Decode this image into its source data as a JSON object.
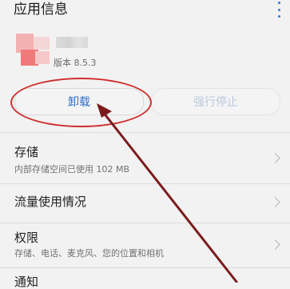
{
  "header": {
    "title": "应用信息",
    "more_icon": "more-vert-icon",
    "accent_color": "#2f74d9"
  },
  "app": {
    "version": "版本 8.5.3"
  },
  "buttons": {
    "uninstall": "卸载",
    "force_stop": "强行停止"
  },
  "settings": [
    {
      "title": "存储",
      "subtitle": "内部存储空间已使用 102 MB"
    },
    {
      "title": "流量使用情况"
    },
    {
      "title": "权限",
      "subtitle": "存储、电话、麦克风、您的位置和相机"
    },
    {
      "title": "通知"
    }
  ],
  "annotation": {
    "circle_color": "#cf2f2f",
    "arrow_color": "#7a1c1c"
  }
}
